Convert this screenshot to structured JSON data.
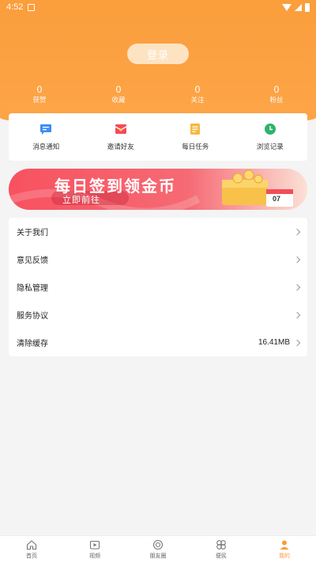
{
  "statusbar": {
    "time": "4:52"
  },
  "profile": {
    "login_label": "登录"
  },
  "stats": [
    {
      "num": "0",
      "label": "获赞"
    },
    {
      "num": "0",
      "label": "收藏"
    },
    {
      "num": "0",
      "label": "关注"
    },
    {
      "num": "0",
      "label": "粉丝"
    }
  ],
  "quick": [
    {
      "label": "消息通知",
      "icon": "message-icon",
      "color": "#3d8df5"
    },
    {
      "label": "邀请好友",
      "icon": "gift-icon",
      "color": "#f34c58"
    },
    {
      "label": "每日任务",
      "icon": "task-icon",
      "color": "#f8b83e"
    },
    {
      "label": "浏览记录",
      "icon": "clock-icon",
      "color": "#2fb36a"
    }
  ],
  "banner": {
    "title": "每日签到领金币",
    "subtitle": "立即前往",
    "calendar_day": "07"
  },
  "menu": [
    {
      "label": "关于我们",
      "value": ""
    },
    {
      "label": "意见反馈",
      "value": ""
    },
    {
      "label": "隐私管理",
      "value": ""
    },
    {
      "label": "服务协议",
      "value": ""
    },
    {
      "label": "清除缓存",
      "value": "16.41MB"
    }
  ],
  "tabs": [
    {
      "label": "首页",
      "icon": "home-icon"
    },
    {
      "label": "视频",
      "icon": "video-icon"
    },
    {
      "label": "朋友圈",
      "icon": "moments-icon"
    },
    {
      "label": "便民",
      "icon": "service-icon"
    },
    {
      "label": "我的",
      "icon": "user-icon"
    }
  ],
  "colors": {
    "primary": "#fb9e3c",
    "banner": "#f8515f"
  }
}
